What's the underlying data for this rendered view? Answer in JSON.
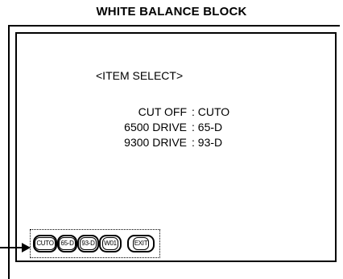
{
  "title": "WHITE BALANCE BLOCK",
  "screen": {
    "heading": "<ITEM SELECT>",
    "items": [
      {
        "label": "CUT OFF",
        "code": ": CUTO"
      },
      {
        "label": "6500  DRIVE",
        "code": ": 65-D"
      },
      {
        "label": "9300  DRIVE",
        "code": ": 93-D"
      }
    ],
    "buttons": [
      "CUTO",
      "65-D",
      "93-D",
      "W01",
      "EXIT"
    ]
  }
}
